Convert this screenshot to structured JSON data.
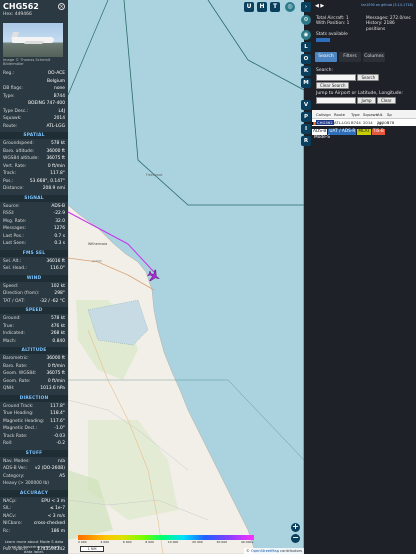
{
  "aircraft": {
    "callsign": "CHG562",
    "hex_label": "Hex:",
    "hex": "449466",
    "photo_credit": "Image © Thomas Schmidt Bildermäler"
  },
  "basic": [
    {
      "k": "Reg.:",
      "v": "OO-ACE"
    },
    {
      "k": "",
      "v": "Belgium"
    },
    {
      "k": "DB flags:",
      "v": "none"
    },
    {
      "k": "Type:",
      "v": "B744"
    },
    {
      "k": "",
      "v": "BOEING 747-400"
    },
    {
      "k": "Type Desc.:",
      "v": "L4J"
    },
    {
      "k": "Squawk:",
      "v": "2014"
    },
    {
      "k": "Route:",
      "v": "ATL-LGG"
    }
  ],
  "sections": {
    "spatial": "SPATIAL",
    "signal": "SIGNAL",
    "fms_sel": "FMS SEL",
    "wind": "WIND",
    "speed": "SPEED",
    "altitude": "ALTITUDE",
    "direction": "DIRECTION",
    "stuff": "STUFF",
    "accuracy": "ACCURACY"
  },
  "spatial": [
    {
      "k": "Groundspeed:",
      "v": "578 kt"
    },
    {
      "k": "Baro. altitude:",
      "v": "36000 ft"
    },
    {
      "k": "WGS84 altitude:",
      "v": "36075 ft"
    },
    {
      "k": "Vert. Rate:",
      "v": "0 ft/min"
    },
    {
      "k": "Track:",
      "v": "117.8°"
    },
    {
      "k": "Pos.:",
      "v": "53.668°, 0.147°"
    },
    {
      "k": "Distance:",
      "v": "208.9 nmi"
    }
  ],
  "signal": [
    {
      "k": "Source:",
      "v": "ADS-B"
    },
    {
      "k": "RSSI:",
      "v": "-22.9"
    },
    {
      "k": "Msg. Rate:",
      "v": "32.0"
    },
    {
      "k": "Messages:",
      "v": "1276"
    },
    {
      "k": "Last Pos.:",
      "v": "0.7 s"
    },
    {
      "k": "Last Seen:",
      "v": "0.3 s"
    }
  ],
  "fms_sel": [
    {
      "k": "Sel. Alt.:",
      "v": "36016 ft"
    },
    {
      "k": "Sel. Head.:",
      "v": "116.0°"
    }
  ],
  "wind": [
    {
      "k": "Speed:",
      "v": "102 kt"
    },
    {
      "k": "Direction (from):",
      "v": "298°"
    },
    {
      "k": "TAT / OAT:",
      "v": "-32 / -62 °C"
    }
  ],
  "speed": [
    {
      "k": "Ground:",
      "v": "578 kt"
    },
    {
      "k": "True:",
      "v": "476 kt"
    },
    {
      "k": "Indicated:",
      "v": "268 kt"
    },
    {
      "k": "Mach:",
      "v": "0.840"
    }
  ],
  "altitude": [
    {
      "k": "Barometric:",
      "v": "36000 ft"
    },
    {
      "k": "Baro. Rate:",
      "v": "0 ft/min"
    },
    {
      "k": "Geom. WGS84:",
      "v": "36075 ft"
    },
    {
      "k": "Geom. Rate:",
      "v": "0 ft/min"
    },
    {
      "k": "QNH:",
      "v": "1013.6 hPa"
    }
  ],
  "direction": [
    {
      "k": "Ground Track:",
      "v": "117.8°"
    },
    {
      "k": "True Heading:",
      "v": "118.4°"
    },
    {
      "k": "Magnetic Heading:",
      "v": "117.6°"
    },
    {
      "k": "Magnetic Decl.:",
      "v": "-1.0°"
    },
    {
      "k": "Track Rate:",
      "v": "-0.03"
    },
    {
      "k": "Roll:",
      "v": "-0.2"
    }
  ],
  "stuff": [
    {
      "k": "Nav. Modes:",
      "v": "n/a"
    },
    {
      "k": "ADS-B Ver.:",
      "v": "v2 (DO-260B)"
    },
    {
      "k": "Category:",
      "v": "A5"
    },
    {
      "k": "Heavy (> 300000 lb)",
      "v": ""
    }
  ],
  "accuracy": [
    {
      "k": "NACp:",
      "v": "EPU < 3 m"
    },
    {
      "k": "SIL:",
      "v": "≤ 1e-7"
    },
    {
      "k": "NACv:",
      "v": "< 3 m/s"
    },
    {
      "k": "NICbaro:",
      "v": "cross-checked"
    },
    {
      "k": "Rc:",
      "v": "186 m"
    }
  ],
  "footer_text": "Learn more about Mode S data type by hovering over each data label.",
  "epoch": {
    "k": "Pos. epoch:",
    "v": "1743594342"
  },
  "map": {
    "top_buttons": [
      "U",
      "H",
      "T"
    ],
    "scale_label": "1 NM",
    "attribution_pre": "© ",
    "attribution_link": "OpenStreetMap",
    "attribution_post": " contributors",
    "alt_ticks": [
      "2 000",
      "4 000",
      "6 000",
      "8 000",
      "10 000",
      "20 000",
      "30 000",
      "40 000+"
    ],
    "zoom_in": "+",
    "zoom_out": "−",
    "water_color": "#aad3df",
    "land_color": "#f2efe9",
    "track_color": "#c535e8"
  },
  "side_buttons": [
    "L",
    "O",
    "K",
    "M",
    "V",
    "P",
    "I",
    "R"
  ],
  "right": {
    "link": "tar1090 on github (3.14.1718)",
    "toggle": "◀ ▶",
    "stats": [
      {
        "a": "Total Aircraft: 1",
        "b": "Messages: 272.0/sec"
      },
      {
        "a": "With Position: 1",
        "b": "History: 2186 positions"
      }
    ],
    "stats_available": "Stats available",
    "tabs": [
      "Search",
      "Filters",
      "Columns"
    ],
    "search_label": "Search:",
    "search_button": "Search",
    "clear_search_button": "Clear Search",
    "jump_label": "Jump to Airport or Latitude, Longitude:",
    "jump_button": "Jump",
    "clear_button": "Clear"
  },
  "table": {
    "headers": [
      "",
      "Callsign",
      "Route",
      "Type",
      "Squawk",
      "Alt. (ft)",
      "Sp"
    ],
    "rows": [
      {
        "callsign": "CHG562",
        "route": "ATL-LGG",
        "type": "B744",
        "squawk": "2014",
        "alt": "36000",
        "sp": "578"
      }
    ]
  },
  "tags": [
    "ADS-B",
    "UAT / ADS-R",
    "MLAT",
    "TIS-B"
  ],
  "modes": "Mode-S"
}
